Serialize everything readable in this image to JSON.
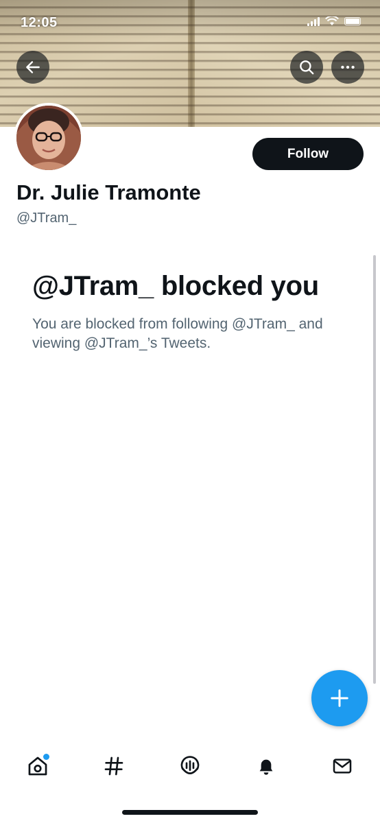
{
  "status_bar": {
    "time": "12:05"
  },
  "header": {
    "back_icon": "arrow-left-icon",
    "search_icon": "search-icon",
    "more_icon": "more-horizontal-icon"
  },
  "profile": {
    "display_name": "Dr. Julie Tramonte",
    "handle": "@JTram_",
    "follow_label": "Follow"
  },
  "blocked": {
    "title": "@JTram_ blocked you",
    "message": "You are blocked from following @JTram_ and viewing @JTram_’s Tweets."
  },
  "fab": {
    "icon": "plus-icon"
  },
  "bottom_nav": {
    "items": [
      {
        "name": "home",
        "icon": "home-icon",
        "has_badge": true
      },
      {
        "name": "explore",
        "icon": "hashtag-icon"
      },
      {
        "name": "spaces",
        "icon": "spaces-icon"
      },
      {
        "name": "notifications",
        "icon": "bell-icon"
      },
      {
        "name": "messages",
        "icon": "mail-icon"
      }
    ]
  },
  "colors": {
    "accent": "#1d9bf0",
    "text_primary": "#0f1419",
    "text_secondary": "#536471",
    "follow_bg": "#0f1419"
  }
}
